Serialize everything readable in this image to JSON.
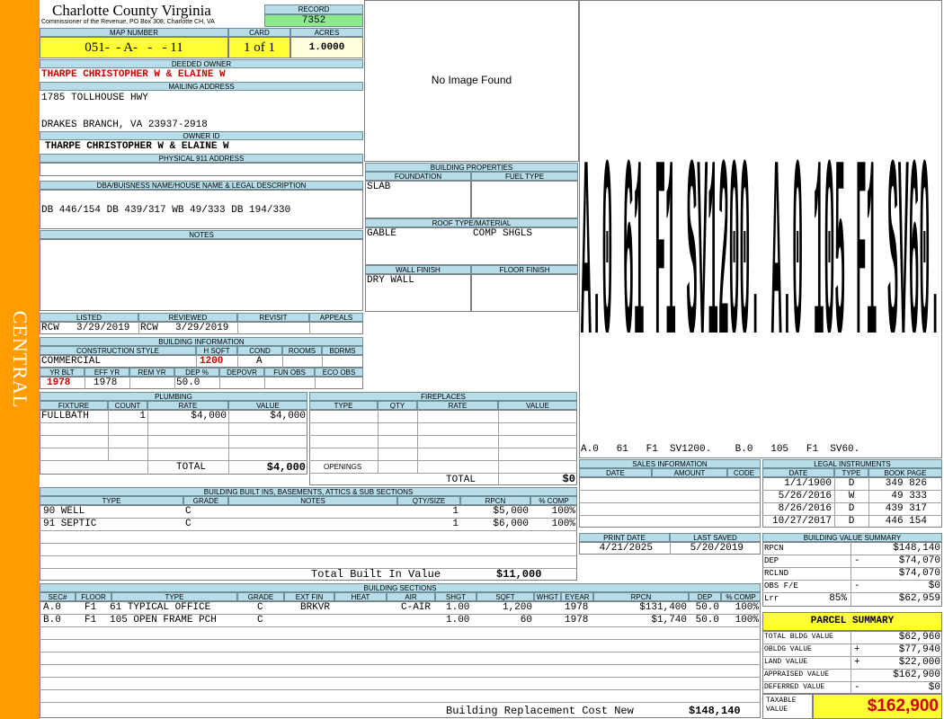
{
  "side_label": "CENTRAL",
  "county": {
    "title": "Charlotte County Virginia",
    "subtitle": "Commissioner of the Revenue, PO Box 308, Charlotte CH, VA"
  },
  "record": {
    "label": "RECORD",
    "value": "7352"
  },
  "map": {
    "label": "MAP NUMBER",
    "value": "051-  - A-   -   - 11"
  },
  "card": {
    "label": "CARD",
    "value": "1 of 1"
  },
  "acres": {
    "label": "ACRES",
    "value": "1.0000"
  },
  "deeded_owner": {
    "label": "DEEDED OWNER",
    "value": "THARPE CHRISTOPHER W & ELAINE W"
  },
  "mailing": {
    "label": "MAILING ADDRESS",
    "line1": "1785 TOLLHOUSE HWY",
    "line2": "DRAKES BRANCH, VA 23937-2918"
  },
  "owner_id": {
    "label": "OWNER ID",
    "value": "THARPE CHRISTOPHER W & ELAINE W"
  },
  "physical": {
    "label": "PHYSICAL 911 ADDRESS",
    "value": ""
  },
  "dba": {
    "label": "DBA/BUISNESS NAME/HOUSE NAME & LEGAL DESCRIPTION",
    "value": "DB 446/154 DB 439/317 WB 49/333 DB 194/330"
  },
  "notes": {
    "label": "NOTES",
    "value": ""
  },
  "photo": {
    "text": "No Image Found"
  },
  "sketch": {
    "caption": "A.0   61   F1  SV1200.    B.0   105   F1  SV60.",
    "glyphs": "A.0 61 F1 SV1200. A.0 105 F1 SV60."
  },
  "listing": {
    "headers": [
      "LISTED",
      "REVIEWED",
      "REVISIT",
      "APPEALS"
    ],
    "listed_by": "RCW",
    "listed_date": "3/29/2019",
    "reviewed_by": "RCW",
    "reviewed_date": "3/29/2019"
  },
  "building_info": {
    "title": "BUILDING INFORMATION",
    "h": {
      "style": "CONSTRUCTION STYLE",
      "hsqft": "H SQFT",
      "cond": "COND",
      "rooms": "ROOMS",
      "bdrms": "BDRMS",
      "yrblt": "YR BLT",
      "effyr": "EFF YR",
      "remyr": "REM YR",
      "dep": "DEP %",
      "depovr": "DEPOVR",
      "funobs": "FUN OBS",
      "ecoobs": "ECO OBS"
    },
    "style": "COMMERCIAL",
    "hsqft": "1200",
    "cond": "A",
    "yrblt": "1978",
    "effyr": "1978",
    "dep": "50.0"
  },
  "building_props": {
    "title": "BUILDING PROPERTIES",
    "foundation_label": "FOUNDATION",
    "fueltype_label": "FUEL TYPE",
    "foundation": "SLAB",
    "roof_label": "ROOF TYPE/MATERIAL",
    "roof_type": "GABLE",
    "roof_material": "COMP SHGLS",
    "wall_label": "WALL FINISH",
    "floor_label": "FLOOR FINISH",
    "wall": "DRY WALL"
  },
  "plumbing": {
    "title": "PLUMBING",
    "headers": [
      "FIXTURE",
      "COUNT",
      "RATE",
      "VALUE"
    ],
    "rows": [
      {
        "fixture": "FULLBATH",
        "count": "1",
        "rate": "$4,000",
        "value": "$4,000"
      }
    ],
    "total_label": "TOTAL",
    "total": "$4,000"
  },
  "fireplaces": {
    "title": "FIREPLACES",
    "headers": [
      "TYPE",
      "QTY",
      "RATE",
      "VALUE"
    ],
    "openings_label": "OPENINGS",
    "total_label": "TOTAL",
    "total": "$0"
  },
  "sales": {
    "title": "SALES INFORMATION",
    "headers": [
      "DATE",
      "AMOUNT",
      "CODE"
    ]
  },
  "legal": {
    "title": "LEGAL INSTRUMENTS",
    "headers": [
      "DATE",
      "TYPE",
      "BOOK PAGE"
    ],
    "rows": [
      {
        "date": "1/1/1900",
        "type": "D",
        "page": "349 826"
      },
      {
        "date": "5/26/2016",
        "type": "W",
        "page": "49 333"
      },
      {
        "date": "8/26/2016",
        "type": "D",
        "page": "439 317"
      },
      {
        "date": "10/27/2017",
        "type": "D",
        "page": "446 154"
      }
    ]
  },
  "print": {
    "print_label": "PRINT DATE",
    "print_date": "4/21/2025",
    "saved_label": "LAST SAVED",
    "saved_date": "5/20/2019"
  },
  "builtins": {
    "title": "BUILDING BUILT INS, BASEMENTS, ATTICS & SUB SECTIONS",
    "headers": [
      "TYPE",
      "GRADE",
      "NOTES",
      "QTY/SIZE",
      "RPCN",
      "% COMP"
    ],
    "rows": [
      {
        "type": "90 WELL",
        "grade": "C",
        "qty": "1",
        "rpcn": "$5,000",
        "comp": "100%"
      },
      {
        "type": "91 SEPTIC",
        "grade": "C",
        "qty": "1",
        "rpcn": "$6,000",
        "comp": "100%"
      }
    ],
    "total_label": "Total Built In Value",
    "total": "$11,000"
  },
  "value_summary": {
    "title": "BUILDING VALUE SUMMARY",
    "rows": [
      {
        "label": "RPCN",
        "sign": "",
        "value": "$148,140"
      },
      {
        "label": "DEP",
        "sign": "-",
        "value": "$74,070"
      },
      {
        "label": "RCLND",
        "sign": "",
        "value": "$74,070"
      },
      {
        "label": "OBS F/E",
        "sign": "-",
        "value": "$0"
      },
      {
        "label": "Lrr",
        "pct": "85%",
        "sign": "",
        "value": "$62,959"
      }
    ]
  },
  "sections": {
    "title": "BUILDING SECTIONS",
    "headers": [
      "SEC#",
      "FLOOR",
      "TYPE",
      "GRADE",
      "EXT FIN",
      "HEAT",
      "AIR",
      "SHGT",
      "SQFT",
      "WHGT",
      "EYEAR",
      "RPCN",
      "DEP",
      "% COMP"
    ],
    "rows": [
      {
        "sec": "A.0",
        "floor": "F1",
        "type": "61 TYPICAL OFFICE",
        "grade": "C",
        "ext": "BRKVR",
        "heat": "",
        "air": "C-AIR",
        "shgt": "1.00",
        "sqft": "1,200",
        "whgt": "",
        "eyear": "1978",
        "rpcn": "$131,400",
        "dep": "50.0",
        "comp": "100%"
      },
      {
        "sec": "B.0",
        "floor": "F1",
        "type": "105 OPEN FRAME PCH",
        "grade": "C",
        "ext": "",
        "heat": "",
        "air": "",
        "shgt": "1.00",
        "sqft": "60",
        "whgt": "",
        "eyear": "1978",
        "rpcn": "$1,740",
        "dep": "50.0",
        "comp": "100%"
      }
    ],
    "total_label": "Building Replacement Cost New",
    "total": "$148,140"
  },
  "parcel": {
    "title": "PARCEL SUMMARY",
    "rows": [
      {
        "label": "TOTAL BLDG VALUE",
        "sign": "",
        "value": "$62,960"
      },
      {
        "label": "OBLDG VALUE",
        "sign": "+",
        "value": "$77,940"
      },
      {
        "label": "LAND VALUE",
        "sign": "+",
        "value": "$22,000"
      },
      {
        "label": "APPRAISED VALUE",
        "sign": "",
        "value": "$162,900"
      },
      {
        "label": "DEFERRED VALUE",
        "sign": "-",
        "value": "$0"
      }
    ],
    "taxable_label": "TAXABLE VALUE",
    "taxable": "$162,900"
  },
  "colors": {
    "side": "#ff9c00",
    "header": "#b7dde8",
    "record": "#8ee88e",
    "map": "#ffff33",
    "parcel": "#ffff33",
    "red": "#d00000"
  }
}
